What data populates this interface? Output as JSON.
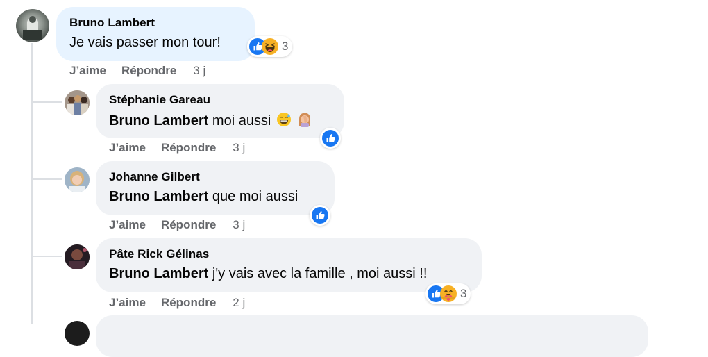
{
  "labels": {
    "like": "J’aime",
    "reply": "Répondre"
  },
  "colors": {
    "like_blue": "#1877f2",
    "main_bubble": "#e7f3ff",
    "reply_bubble": "#f0f2f5",
    "meta": "#65676b"
  },
  "comments": [
    {
      "author": "Bruno Lambert",
      "text": "Je vais passer mon tour!",
      "time": "3 j",
      "reactions": {
        "icons": [
          "like-icon",
          "haha-icon"
        ],
        "count": "3"
      }
    },
    {
      "author": "Stéphanie Gareau",
      "mention": "Bruno Lambert",
      "text": "moi aussi",
      "emojis": [
        "grinning-sweat-emoji",
        "facepalm-emoji"
      ],
      "time": "3 j",
      "reactions": {
        "icons": [
          "like-icon"
        ]
      }
    },
    {
      "author": "Johanne Gilbert",
      "mention": "Bruno Lambert",
      "text": "que moi aussi",
      "time": "3 j",
      "reactions": {
        "icons": [
          "like-icon"
        ]
      }
    },
    {
      "author": "Pâte Rick Gélinas",
      "mention": "Bruno Lambert",
      "text": "j'y vais avec la famille , moi aussi !!",
      "time": "2 j",
      "reactions": {
        "icons": [
          "like-icon",
          "care-icon"
        ],
        "count": "3"
      }
    }
  ]
}
